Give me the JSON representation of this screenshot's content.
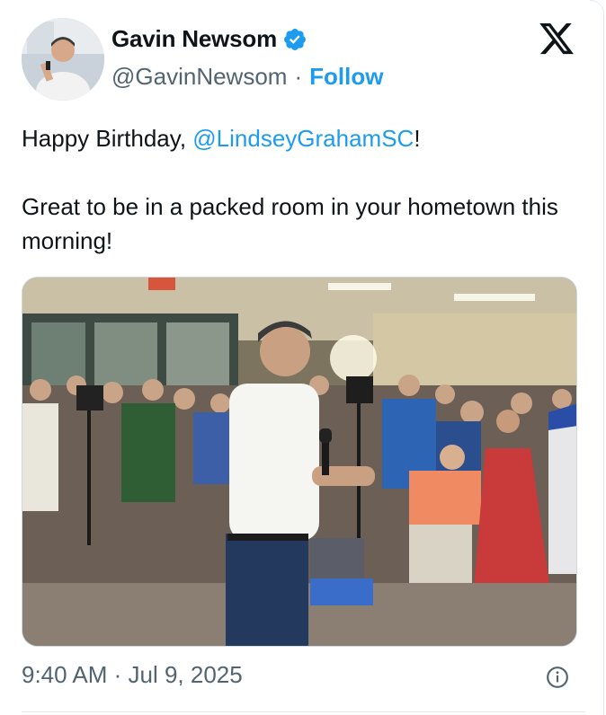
{
  "header": {
    "name": "Gavin Newsom",
    "handle": "@GavinNewsom",
    "separator": "·",
    "follow_label": "Follow",
    "verified_icon": "verified-badge-icon",
    "platform_icon": "x-logo-icon",
    "accent": "#1d9bf0"
  },
  "tweet": {
    "line1_prefix": "Happy Birthday, ",
    "line1_mention": "@LindseyGrahamSC",
    "line1_suffix": "!",
    "line2": "Great to be in a packed room in your hometown this morning!"
  },
  "media": {
    "type": "photo"
  },
  "footer": {
    "timestamp": "9:40 AM · Jul 9, 2025",
    "info_icon": "info-icon"
  }
}
